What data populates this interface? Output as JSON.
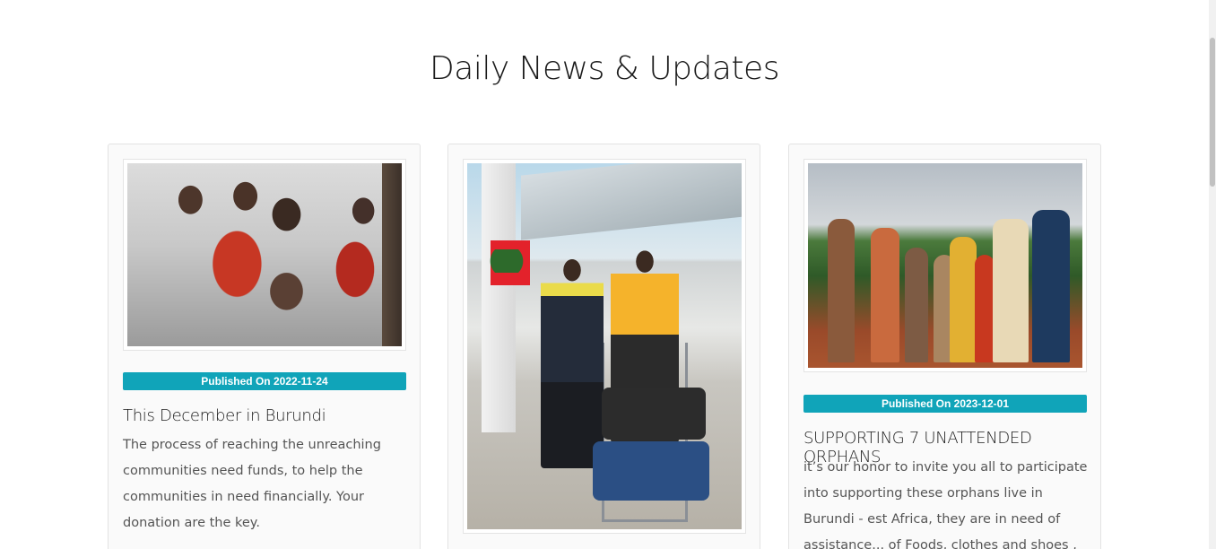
{
  "section": {
    "title": "Daily News & Updates"
  },
  "cards": [
    {
      "published": "Published On 2022-11-24",
      "title": "This December in Burundi",
      "text": "The process of reaching the unreaching communities need funds, to help the communities in need financially. Your donation are the key."
    },
    {
      "published": "",
      "title": "",
      "text": ""
    },
    {
      "published": "Published On 2023-12-01",
      "title": "SUPPORTING 7 UNATTENDED ORPHANS",
      "text": "it’s our honor to invite you all to participate into supporting these orphans live in Burundi - est Africa, they are in need of assistance... of Foods, clothes and shoes ,"
    }
  ],
  "colors": {
    "badge": "#10a4b9",
    "card_border": "#e3e3e3"
  }
}
